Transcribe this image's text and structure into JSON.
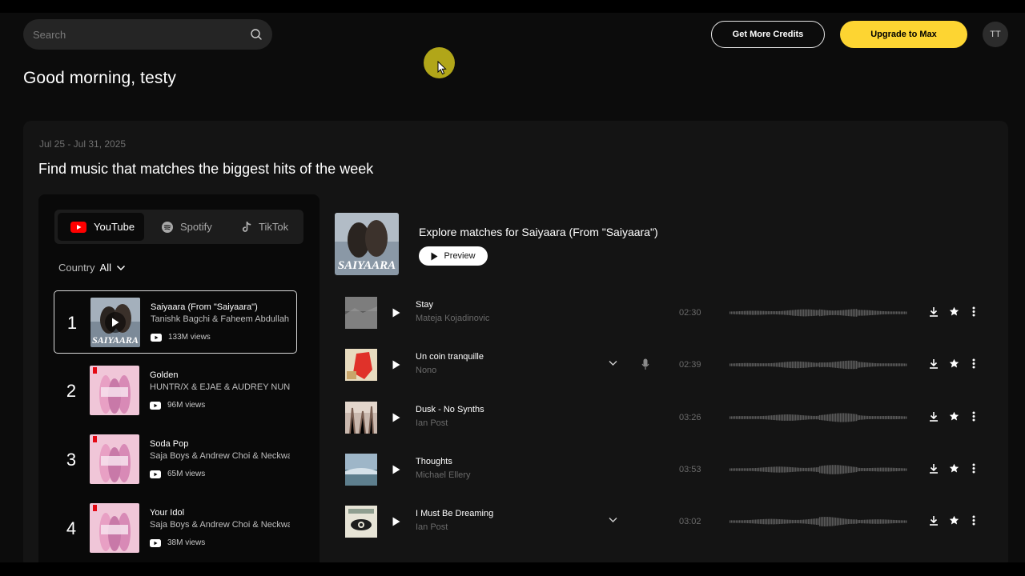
{
  "header": {
    "search_placeholder": "Search",
    "credits_label": "Get More Credits",
    "upgrade_label": "Upgrade to Max",
    "avatar_initials": "TT",
    "accent_color": "#fdd532"
  },
  "greeting": "Good morning, testy",
  "hits": {
    "date_range": "Jul 25 - Jul 31, 2025",
    "title": "Find music that matches the biggest hits of the week",
    "tabs": [
      {
        "label": "YouTube",
        "icon": "youtube-icon",
        "active": true
      },
      {
        "label": "Spotify",
        "icon": "spotify-icon",
        "active": false
      },
      {
        "label": "TikTok",
        "icon": "tiktok-icon",
        "active": false
      }
    ],
    "country_label": "Country",
    "country_value": "All",
    "chart": [
      {
        "rank": "1",
        "title": "Saiyaara (From \"Saiyaara\")",
        "artist": "Tanishk Bagchi & Faheem Abdullah",
        "views": "133M views"
      },
      {
        "rank": "2",
        "title": "Golden",
        "artist": "HUNTR/X & EJAE & AUDREY NUNA",
        "views": "96M views"
      },
      {
        "rank": "3",
        "title": "Soda Pop",
        "artist": "Saja Boys & Andrew Choi & Neckwav",
        "views": "65M views"
      },
      {
        "rank": "4",
        "title": "Your Idol",
        "artist": "Saja Boys & Andrew Choi & Neckwav",
        "views": "38M views"
      }
    ]
  },
  "explore": {
    "title": "Explore matches for Saiyaara (From \"Saiyaara\")",
    "cover_text": "SAIYAARA",
    "preview_label": "Preview"
  },
  "tracks": [
    {
      "title": "Stay",
      "artist": "Mateja Kojadinovic",
      "duration": "02:30",
      "has_chevron": false,
      "has_mic": false
    },
    {
      "title": "Un coin tranquille",
      "artist": "Nono",
      "duration": "02:39",
      "has_chevron": true,
      "has_mic": true
    },
    {
      "title": "Dusk - No Synths",
      "artist": "Ian Post",
      "duration": "03:26",
      "has_chevron": false,
      "has_mic": false
    },
    {
      "title": "Thoughts",
      "artist": "Michael Ellery",
      "duration": "03:53",
      "has_chevron": false,
      "has_mic": false
    },
    {
      "title": "I Must Be Dreaming",
      "artist": "Ian Post",
      "duration": "03:02",
      "has_chevron": true,
      "has_mic": false
    }
  ]
}
